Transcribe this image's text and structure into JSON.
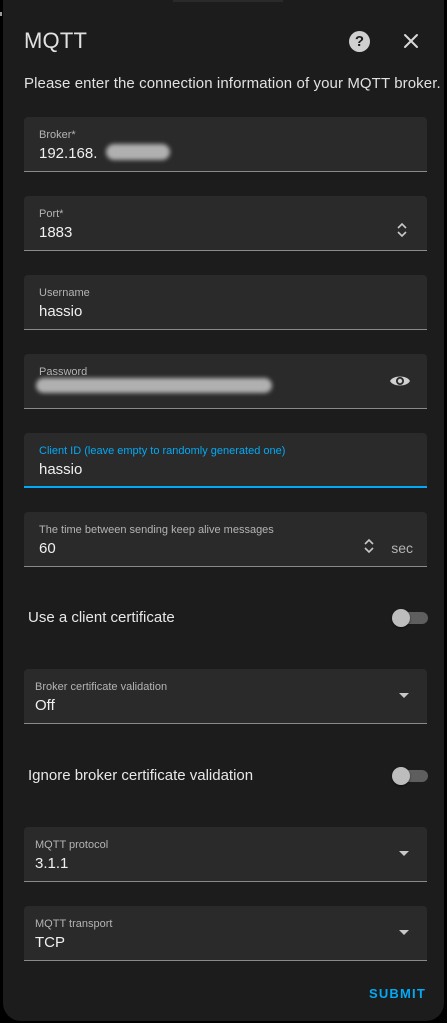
{
  "dialog": {
    "title": "MQTT",
    "intro": "Please enter the connection information of your MQTT broker.",
    "submit_label": "SUBMIT",
    "accent_color": "#03a9f4"
  },
  "fields": {
    "broker": {
      "label": "Broker*",
      "value": "192.168."
    },
    "port": {
      "label": "Port*",
      "value": "1883"
    },
    "username": {
      "label": "Username",
      "value": "hassio"
    },
    "password": {
      "label": "Password"
    },
    "client_id": {
      "label": "Client ID (leave empty to randomly generated one)",
      "value": "hassio"
    },
    "keepalive": {
      "label": "The time between sending keep alive messages",
      "value": "60",
      "suffix": "sec"
    }
  },
  "toggles": {
    "client_cert": {
      "label": "Use a client certificate",
      "checked": false
    },
    "ignore_validation": {
      "label": "Ignore broker certificate validation",
      "checked": false
    }
  },
  "selects": {
    "cert_validation": {
      "label": "Broker certificate validation",
      "value": "Off"
    },
    "protocol": {
      "label": "MQTT protocol",
      "value": "3.1.1"
    },
    "transport": {
      "label": "MQTT transport",
      "value": "TCP"
    }
  },
  "icons": {
    "help": "help-circle-icon",
    "close": "close-icon",
    "eye": "eye-icon",
    "stepper": "stepper-arrows-icon",
    "dropdown": "dropdown-arrow-icon"
  }
}
